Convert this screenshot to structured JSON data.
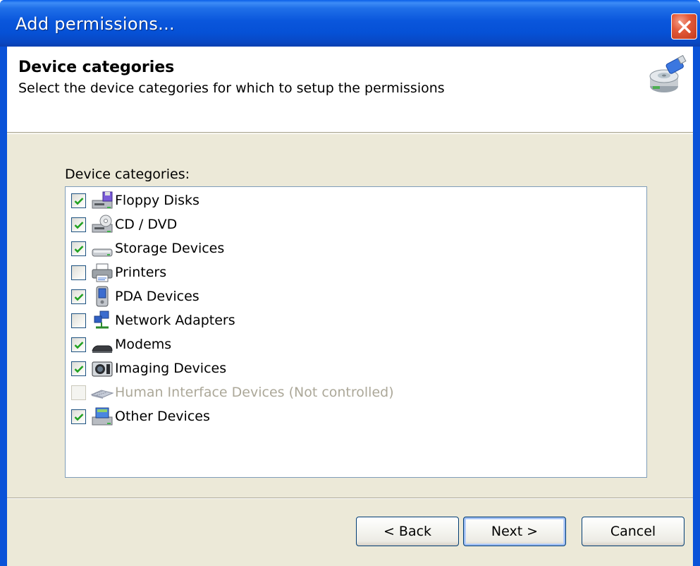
{
  "window": {
    "title": "Add permissions..."
  },
  "header": {
    "title": "Device categories",
    "subtitle": "Select the device categories for which to setup the permissions",
    "icon": "usb-drive-icon"
  },
  "list": {
    "label": "Device categories:",
    "items": [
      {
        "label": "Floppy Disks",
        "checked": true,
        "enabled": true,
        "icon": "floppy-drive-icon"
      },
      {
        "label": "CD / DVD",
        "checked": true,
        "enabled": true,
        "icon": "cd-dvd-drive-icon"
      },
      {
        "label": "Storage Devices",
        "checked": true,
        "enabled": true,
        "icon": "storage-device-icon"
      },
      {
        "label": "Printers",
        "checked": false,
        "enabled": true,
        "icon": "printer-icon"
      },
      {
        "label": "PDA Devices",
        "checked": true,
        "enabled": true,
        "icon": "pda-icon"
      },
      {
        "label": "Network Adapters",
        "checked": false,
        "enabled": true,
        "icon": "network-adapter-icon"
      },
      {
        "label": "Modems",
        "checked": true,
        "enabled": true,
        "icon": "modem-icon"
      },
      {
        "label": "Imaging Devices",
        "checked": true,
        "enabled": true,
        "icon": "camera-icon"
      },
      {
        "label": "Human Interface Devices (Not controlled)",
        "checked": false,
        "enabled": false,
        "icon": "keyboard-icon"
      },
      {
        "label": "Other Devices",
        "checked": true,
        "enabled": true,
        "icon": "other-devices-icon"
      }
    ]
  },
  "buttons": {
    "back": "< Back",
    "next": "Next >",
    "cancel": "Cancel"
  },
  "colors": {
    "titlebar": "#0a56dc",
    "dialog_face": "#ece9d8",
    "check_green": "#21a121",
    "close_red": "#e35a3a"
  }
}
